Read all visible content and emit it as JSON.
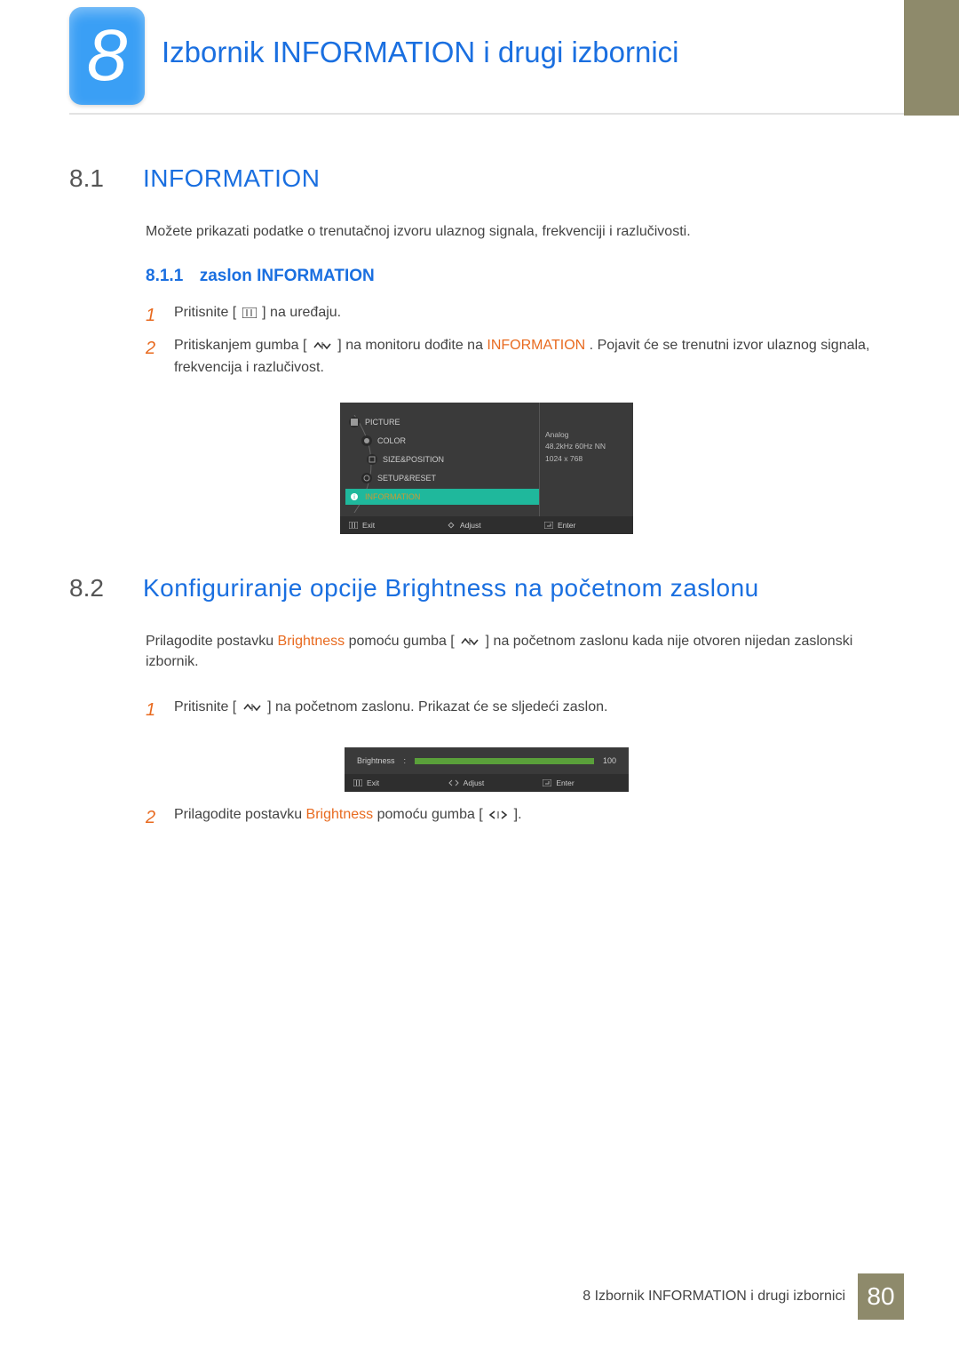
{
  "chapter": {
    "number": "8",
    "title": "Izbornik INFORMATION i drugi izbornici"
  },
  "s81": {
    "num": "8.1",
    "title": "INFORMATION",
    "intro": "Možete prikazati podatke o trenutačnoj izvoru ulaznog signala, frekvenciji i razlučivosti.",
    "sub_num": "8.1.1",
    "sub_title": "zaslon INFORMATION",
    "step1_a": "Pritisnite [",
    "step1_b": "] na uređaju.",
    "step2_a": "Pritiskanjem gumba [",
    "step2_b": "] na monitoru dođite na ",
    "step2_hi": "INFORMATION",
    "step2_c": ". Pojavit će se trenutni izvor ulaznog signala, frekvencija i razlučivost."
  },
  "osd": {
    "items": [
      "PICTURE",
      "COLOR",
      "SIZE&POSITION",
      "SETUP&RESET",
      "INFORMATION"
    ],
    "info": [
      "Analog",
      "48.2kHz 60Hz NN",
      "1024 x 768"
    ],
    "foot": {
      "exit": "Exit",
      "adjust": "Adjust",
      "enter": "Enter"
    }
  },
  "s82": {
    "num": "8.2",
    "title": "Konfiguriranje opcije Brightness na početnom zaslonu",
    "intro_a": "Prilagodite postavku ",
    "intro_hi": "Brightness",
    "intro_b": " pomoću gumba [",
    "intro_c": "] na početnom zaslonu kada nije otvoren nijedan zaslonski izbornik.",
    "step1_a": "Pritisnite [",
    "step1_b": "] na početnom zaslonu. Prikazat će se sljedeći zaslon.",
    "step2_a": "Prilagodite postavku ",
    "step2_hi": "Brightness",
    "step2_b": " pomoću gumba [",
    "step2_c": "]."
  },
  "osd2": {
    "label": "Brightness",
    "sep": ":",
    "value": "100",
    "foot": {
      "exit": "Exit",
      "adjust": "Adjust",
      "enter": "Enter"
    }
  },
  "footer": {
    "text": "8 Izbornik INFORMATION i drugi izbornici",
    "page": "80"
  }
}
